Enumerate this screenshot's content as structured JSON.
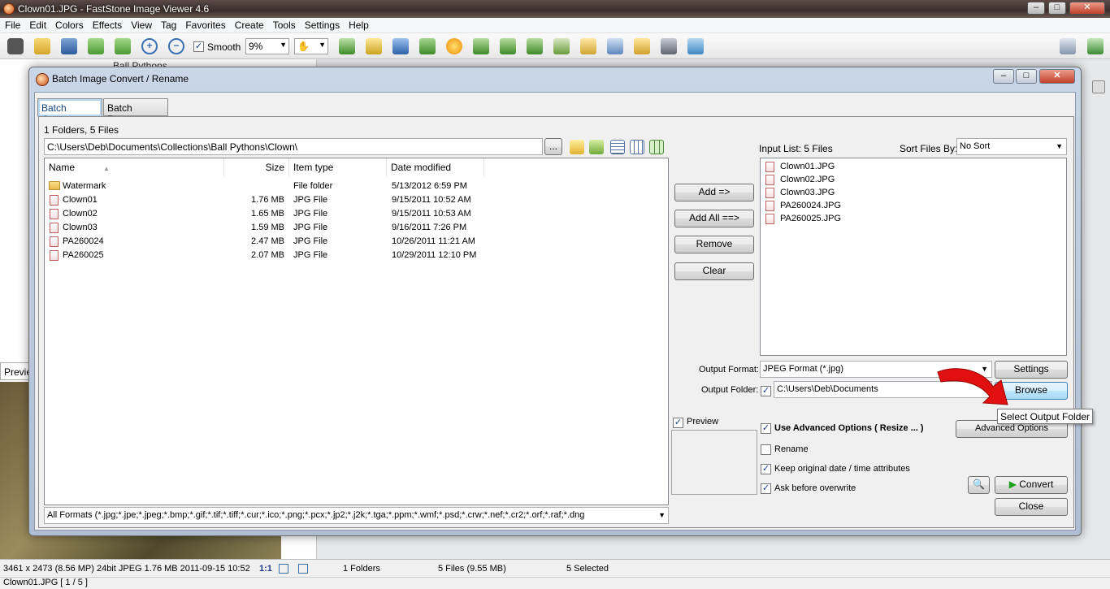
{
  "window": {
    "title": "Clown01.JPG  -  FastStone Image Viewer 4.6"
  },
  "menu": [
    "File",
    "Edit",
    "Colors",
    "Effects",
    "View",
    "Tag",
    "Favorites",
    "Create",
    "Tools",
    "Settings",
    "Help"
  ],
  "toolbar": {
    "smooth_label": "Smooth",
    "zoom_value": "9%"
  },
  "background": {
    "tree_item": "Ball Pythons",
    "preview_tab": "Previe"
  },
  "status": {
    "image_info": "3461 x 2473 (8.56 MP)  24bit  JPEG   1.76 MB   2011-09-15 10:52",
    "ratio": "1:1",
    "folders": "1 Folders",
    "files": "5 Files (9.55 MB)",
    "selected": "5 Selected",
    "file_position": "Clown01.JPG [ 1 / 5 ]"
  },
  "dialog": {
    "title": "Batch Image Convert / Rename",
    "tabs": [
      "Batch Convert",
      "Batch Rename"
    ],
    "folder_summary": "1 Folders, 5 Files",
    "path": "C:\\Users\\Deb\\Documents\\Collections\\Ball Pythons\\Clown\\",
    "path_browse": "...",
    "columns": [
      "Name",
      "Size",
      "Item type",
      "Date modified"
    ],
    "files": [
      {
        "name": "Watermark",
        "size": "",
        "type": "File folder",
        "date": "5/13/2012 6:59 PM",
        "kind": "folder"
      },
      {
        "name": "Clown01",
        "size": "1.76 MB",
        "type": "JPG File",
        "date": "9/15/2011 10:52 AM",
        "kind": "file"
      },
      {
        "name": "Clown02",
        "size": "1.65 MB",
        "type": "JPG File",
        "date": "9/15/2011 10:53 AM",
        "kind": "file"
      },
      {
        "name": "Clown03",
        "size": "1.59 MB",
        "type": "JPG File",
        "date": "9/16/2011 7:26 PM",
        "kind": "file"
      },
      {
        "name": "PA260024",
        "size": "2.47 MB",
        "type": "JPG File",
        "date": "10/26/2011 11:21 AM",
        "kind": "file"
      },
      {
        "name": "PA260025",
        "size": "2.07 MB",
        "type": "JPG File",
        "date": "10/29/2011 12:10 PM",
        "kind": "file"
      }
    ],
    "filter": "All Formats (*.jpg;*.jpe;*.jpeg;*.bmp;*.gif;*.tif;*.tiff;*.cur;*.ico;*.png;*.pcx;*.jp2;*.j2k;*.tga;*.ppm;*.wmf;*.psd;*.crw;*.nef;*.cr2;*.orf;*.raf;*.dng",
    "buttons": {
      "add": "Add =>",
      "add_all": "Add All ==>",
      "remove": "Remove",
      "clear": "Clear"
    },
    "input_list_label": "Input List:  5 Files",
    "sort_label": "Sort Files By:",
    "sort_value": "No Sort",
    "input_files": [
      "Clown01.JPG",
      "Clown02.JPG",
      "Clown03.JPG",
      "PA260024.JPG",
      "PA260025.JPG"
    ],
    "output_format_label": "Output Format:",
    "output_format_value": "JPEG Format (*.jpg)",
    "settings_label": "Settings",
    "output_folder_label": "Output Folder:",
    "output_folder_value": "C:\\Users\\Deb\\Documents",
    "browse_label": "Browse",
    "tooltip": "Select Output Folder",
    "preview_label": "Preview",
    "use_advanced_label": "Use Advanced Options ( Resize ... )",
    "advanced_options_label": "Advanced Options",
    "rename_label": "Rename",
    "keep_date_label": "Keep original date / time attributes",
    "ask_overwrite_label": "Ask before overwrite",
    "convert_label": "Convert",
    "close_label": "Close"
  },
  "colors": {
    "accent_arrow": "#e01010",
    "browse_hover": "#bee6fd"
  }
}
